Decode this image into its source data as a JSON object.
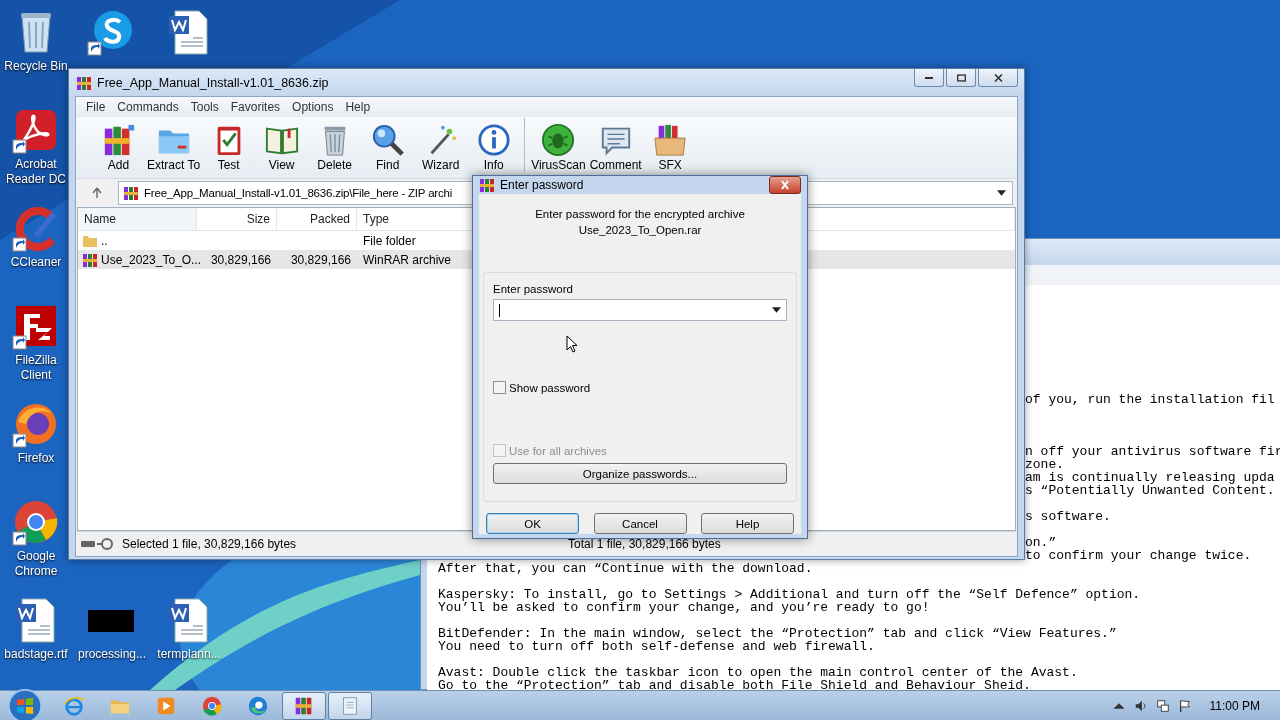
{
  "desktop": {
    "left_icons": [
      {
        "kind": "recycle",
        "label": "Recycle Bin",
        "shortcut": false
      },
      {
        "kind": "acrobat",
        "label": "Acrobat Reader DC",
        "shortcut": true
      },
      {
        "kind": "ccleaner",
        "label": "CCleaner",
        "shortcut": true
      },
      {
        "kind": "filezilla",
        "label": "FileZilla Client",
        "shortcut": true
      },
      {
        "kind": "firefox",
        "label": "Firefox",
        "shortcut": true
      },
      {
        "kind": "chrome",
        "label": "Google Chrome",
        "shortcut": true
      },
      {
        "kind": "word",
        "label": "badstage.rtf",
        "shortcut": false
      }
    ],
    "top_icons": [
      {
        "kind": "skype",
        "shortcut": true
      },
      {
        "kind": "word",
        "shortcut": false
      }
    ],
    "bottom_icons": [
      {
        "kind": "blank",
        "label": "processing...",
        "shortcut": false
      },
      {
        "kind": "word",
        "label": "termplann...",
        "shortcut": false
      }
    ]
  },
  "notepad": {
    "fragments": [
      [
        "of you, run the installation fil"
      ],
      [
        "n off your antivirus software fir",
        "zone.",
        "am is continually releasing upda",
        "s “Potentially Unwanted Content."
      ],
      [
        "s software."
      ],
      [
        "on.”",
        "to confirm your change twice."
      ]
    ],
    "paragraphs": [
      [
        "After that, you can “Continue with the download."
      ],
      [
        "Kaspersky: To install, go to Settings > Additional and turn off the “Self Defence” option.",
        "You’ll be asked to confirm your change, and you’re ready to go!"
      ],
      [
        "BitDefender: In the main window, select the “Protection” tab and click “View Features.”",
        "You need to turn off both self-defense and web firewall."
      ],
      [
        "Avast: Double click the taskbar icon to open the main control center of the Avast.",
        "Go to the “Protection” tab and disable both File Shield and Behaviour Sheid."
      ]
    ]
  },
  "winrar": {
    "title": "Free_App_Manual_Install-v1.01_8636.zip",
    "menu": [
      "File",
      "Commands",
      "Tools",
      "Favorites",
      "Options",
      "Help"
    ],
    "toolbar_groups": [
      [
        {
          "kind": "add",
          "label": "Add"
        },
        {
          "kind": "extract",
          "label": "Extract To"
        },
        {
          "kind": "test",
          "label": "Test"
        },
        {
          "kind": "view",
          "label": "View"
        },
        {
          "kind": "delete",
          "label": "Delete"
        },
        {
          "kind": "find",
          "label": "Find"
        },
        {
          "kind": "wizard",
          "label": "Wizard"
        },
        {
          "kind": "info",
          "label": "Info"
        }
      ],
      [
        {
          "kind": "virusscan",
          "label": "VirusScan"
        },
        {
          "kind": "comment",
          "label": "Comment"
        },
        {
          "kind": "sfx",
          "label": "SFX"
        }
      ]
    ],
    "path": "Free_App_Manual_Install-v1.01_8636.zip\\File_here - ZIP archi",
    "columns": [
      "Name",
      "Size",
      "Packed",
      "Type"
    ],
    "rows": [
      {
        "kind": "folder",
        "name": "..",
        "type": "File folder",
        "selected": false
      },
      {
        "kind": "archive",
        "name": "Use_2023_To_O...",
        "size": "30,829,166",
        "packed": "30,829,166",
        "type": "WinRAR archive",
        "selected": true
      }
    ],
    "status": [
      "Selected 1 file, 30,829,166 bytes",
      "Total 1 file, 30,829,166 bytes"
    ]
  },
  "dialog": {
    "title": "Enter password",
    "message": [
      "Enter password for the encrypted archive",
      "Use_2023_To_Open.rar"
    ],
    "field_label": "Enter password",
    "checkboxes": [
      {
        "label": "Show password",
        "checked": false,
        "disabled": false
      },
      {
        "label": "Use for all archives",
        "checked": false,
        "disabled": true
      }
    ],
    "organize_button": "Organize passwords...",
    "buttons": [
      {
        "label": "OK",
        "focused": true
      },
      {
        "label": "Cancel",
        "focused": false
      },
      {
        "label": "Help",
        "focused": false
      }
    ]
  },
  "taskbar": {
    "apps": [
      {
        "kind": "ie",
        "running": false
      },
      {
        "kind": "explorer",
        "running": false
      },
      {
        "kind": "media",
        "running": false
      },
      {
        "kind": "chrome",
        "running": false
      },
      {
        "kind": "edge",
        "running": false
      },
      {
        "kind": "winrar",
        "running": true
      },
      {
        "kind": "notepad",
        "running": true
      }
    ],
    "clock": "11:00 PM"
  }
}
